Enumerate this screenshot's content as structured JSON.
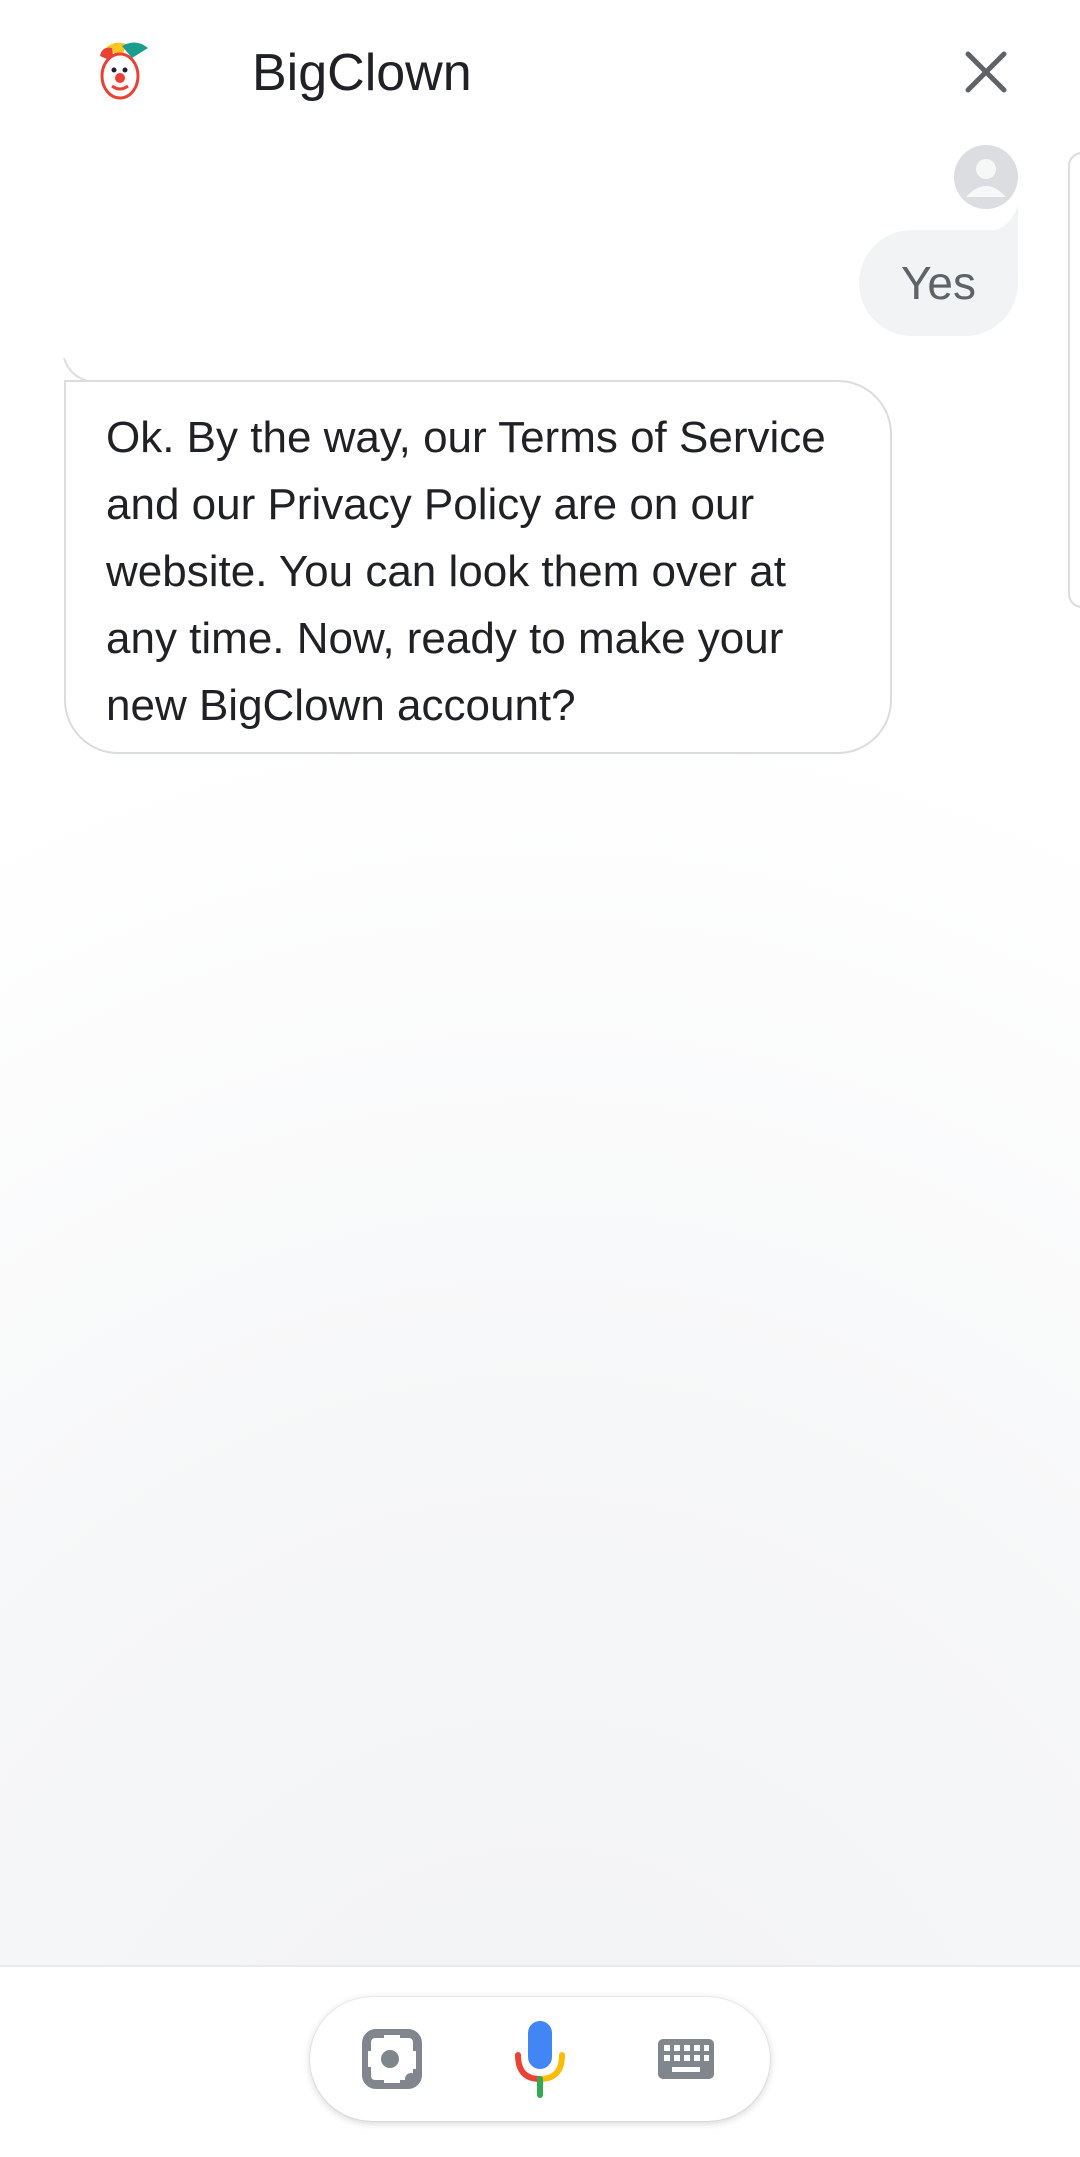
{
  "header": {
    "title": "BigClown",
    "logo_icon": "clown-logo-icon",
    "close_icon": "close-icon"
  },
  "conversation": {
    "user_message": "Yes",
    "assistant_message": "Ok. By the way, our Terms of Service and our Privacy Policy are on our website. You can look them over at any time. Now, ready to make your new BigClown account?"
  },
  "bottom_bar": {
    "lens_icon": "lens-icon",
    "mic_icon": "microphone-icon",
    "keyboard_icon": "keyboard-icon"
  },
  "colors": {
    "google_blue": "#4285F4",
    "google_red": "#EA4335",
    "google_yellow": "#FBBC04",
    "google_green": "#34A853",
    "text_primary": "#202124",
    "text_secondary": "#5f6368"
  }
}
